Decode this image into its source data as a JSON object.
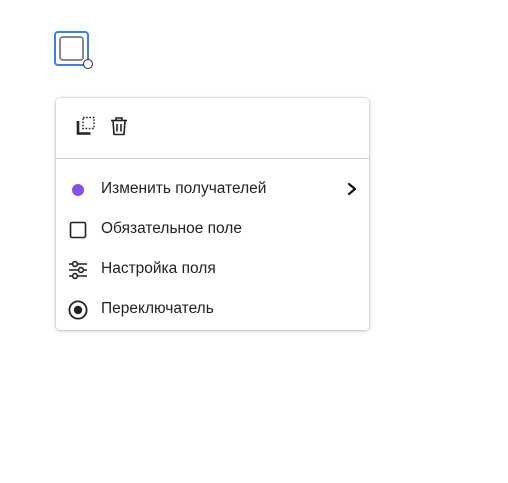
{
  "menu": {
    "items": [
      {
        "label": "Изменить получателей",
        "icon": "recipient-dot-icon",
        "color": "#8451e8",
        "submenu": true
      },
      {
        "label": "Обязательное поле",
        "icon": "checkbox-empty-icon"
      },
      {
        "label": "Настройка поля",
        "icon": "sliders-icon"
      },
      {
        "label": "Переключатель",
        "icon": "radio-button-icon"
      }
    ]
  },
  "toolbar": {
    "buttons": [
      {
        "icon": "duplicate-icon"
      },
      {
        "icon": "trash-icon"
      }
    ]
  },
  "field": {
    "type": "checkbox",
    "selected": true,
    "accent": "#3b80e8"
  }
}
